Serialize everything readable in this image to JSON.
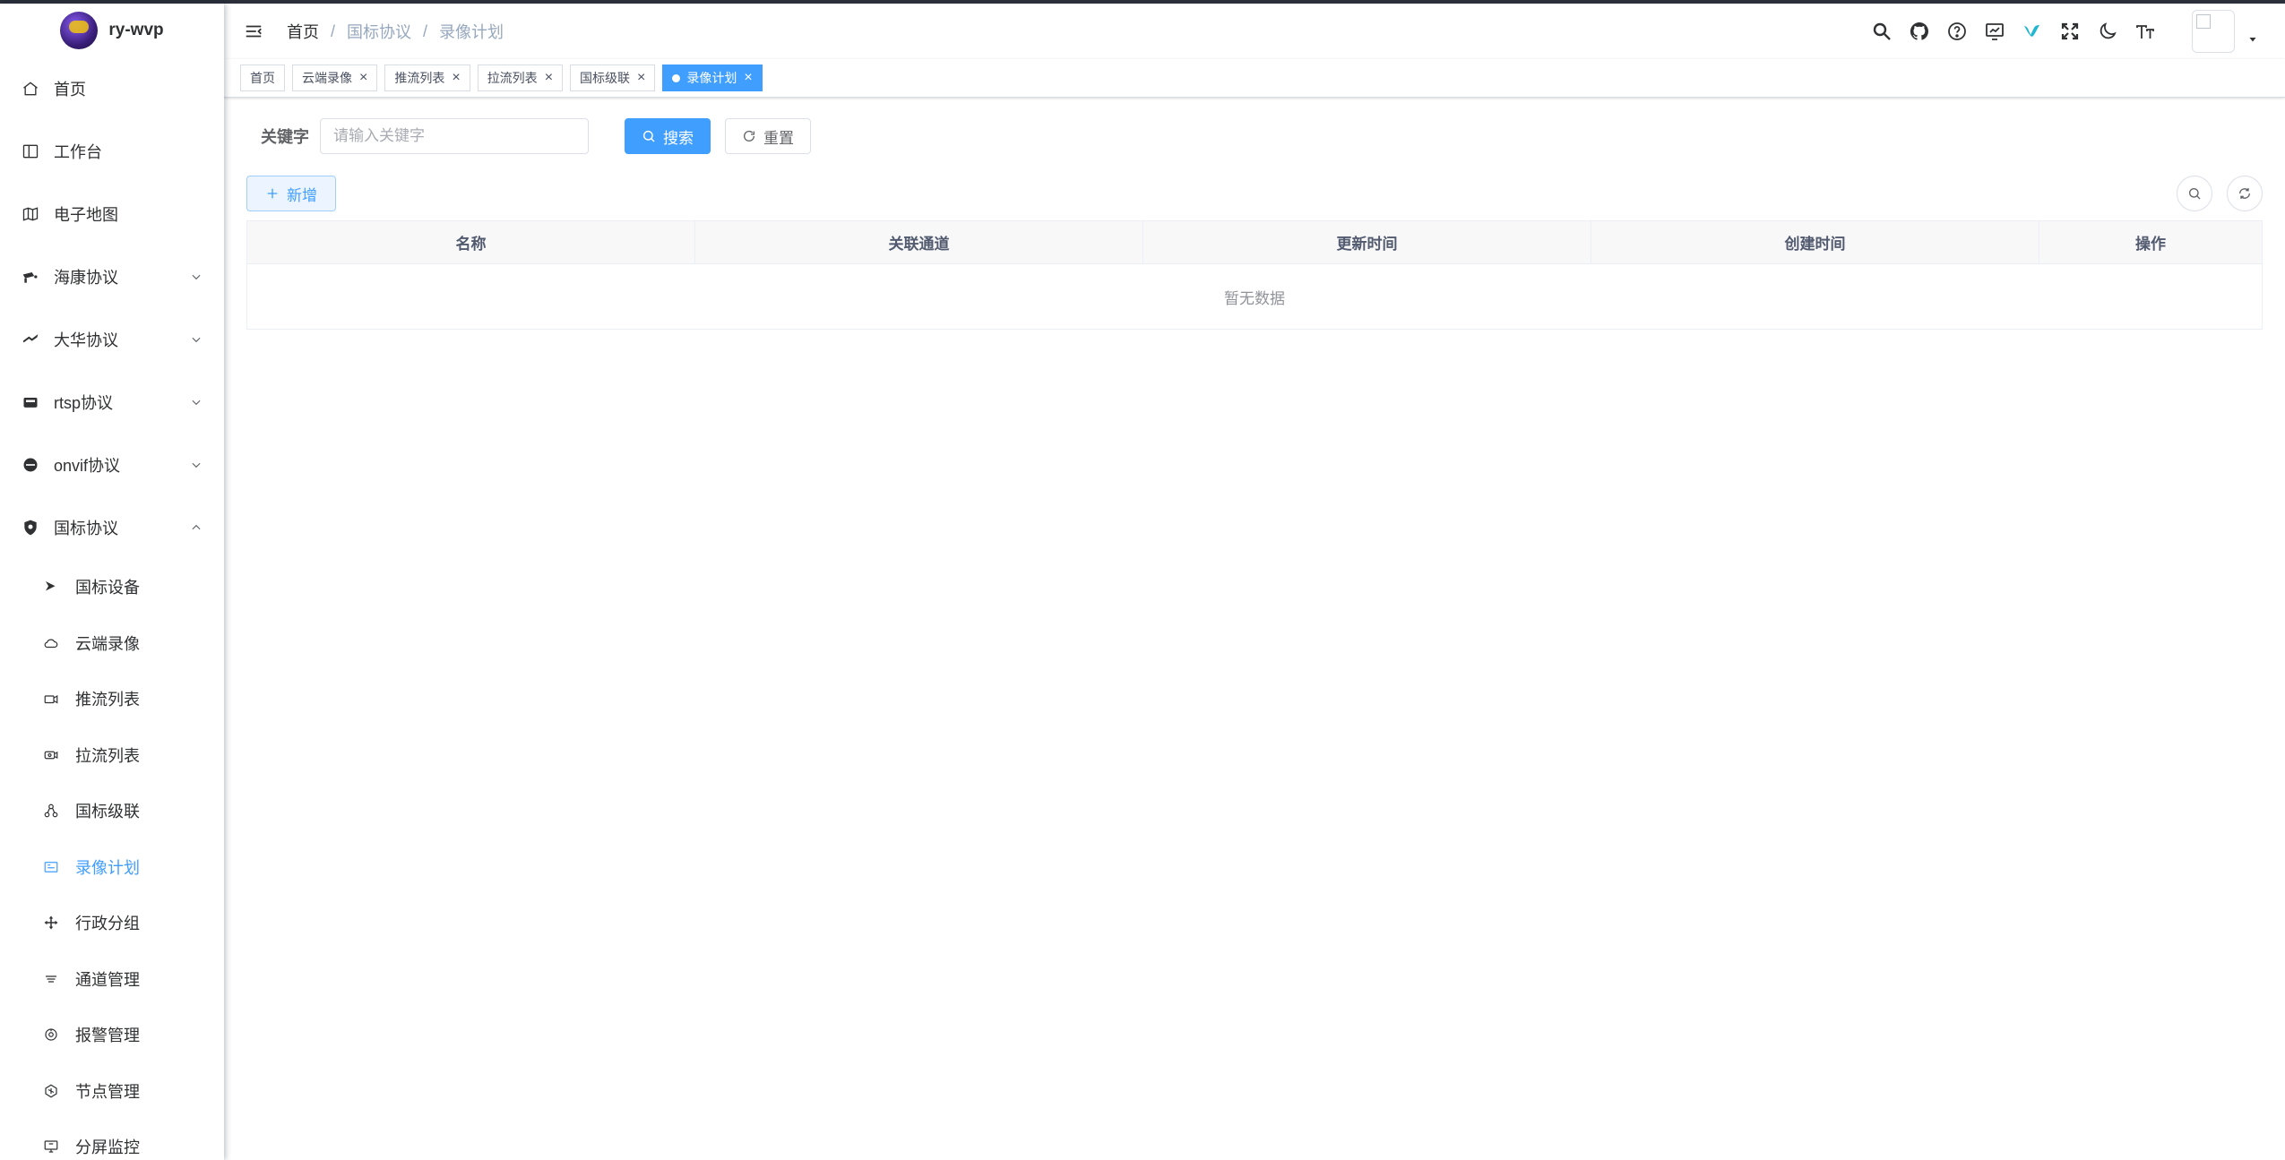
{
  "app": {
    "title": "ry-wvp"
  },
  "sidebar": {
    "items": [
      {
        "label": "首页",
        "icon": "home-icon"
      },
      {
        "label": "工作台",
        "icon": "workbench-icon"
      },
      {
        "label": "电子地图",
        "icon": "map-icon"
      },
      {
        "label": "海康协议",
        "icon": "camera-icon",
        "expanded": false
      },
      {
        "label": "大华协议",
        "icon": "dahua-icon",
        "expanded": false
      },
      {
        "label": "rtsp协议",
        "icon": "rtsp-icon",
        "expanded": false
      },
      {
        "label": "onvif协议",
        "icon": "onvif-icon",
        "expanded": false
      },
      {
        "label": "国标协议",
        "icon": "shield-icon",
        "expanded": true
      }
    ],
    "sub_items": [
      {
        "label": "国标设备",
        "icon": "device-icon"
      },
      {
        "label": "云端录像",
        "icon": "cloud-icon"
      },
      {
        "label": "推流列表",
        "icon": "push-stream-icon"
      },
      {
        "label": "拉流列表",
        "icon": "pull-stream-icon"
      },
      {
        "label": "国标级联",
        "icon": "cascade-icon"
      },
      {
        "label": "录像计划",
        "icon": "record-plan-icon",
        "active": true
      },
      {
        "label": "行政分组",
        "icon": "group-icon"
      },
      {
        "label": "通道管理",
        "icon": "channel-icon"
      },
      {
        "label": "报警管理",
        "icon": "alarm-icon"
      },
      {
        "label": "节点管理",
        "icon": "node-icon"
      },
      {
        "label": "分屏监控",
        "icon": "monitor-icon"
      }
    ]
  },
  "breadcrumb": [
    "首页",
    "国标协议",
    "录像计划"
  ],
  "tags": [
    {
      "label": "首页",
      "closable": false
    },
    {
      "label": "云端录像",
      "closable": true
    },
    {
      "label": "推流列表",
      "closable": true
    },
    {
      "label": "拉流列表",
      "closable": true
    },
    {
      "label": "国标级联",
      "closable": true
    },
    {
      "label": "录像计划",
      "closable": true,
      "active": true
    }
  ],
  "tag_close_glyph": "×",
  "search": {
    "label": "关键字",
    "placeholder": "请输入关键字",
    "value": "",
    "search_button": "搜索",
    "reset_button": "重置"
  },
  "actions": {
    "add_button": "新增"
  },
  "table": {
    "columns": [
      "名称",
      "关联通道",
      "更新时间",
      "创建时间",
      "操作"
    ],
    "empty_text": "暂无数据"
  },
  "colors": {
    "primary": "#409eff",
    "text": "#303133",
    "muted": "#97a8be"
  }
}
